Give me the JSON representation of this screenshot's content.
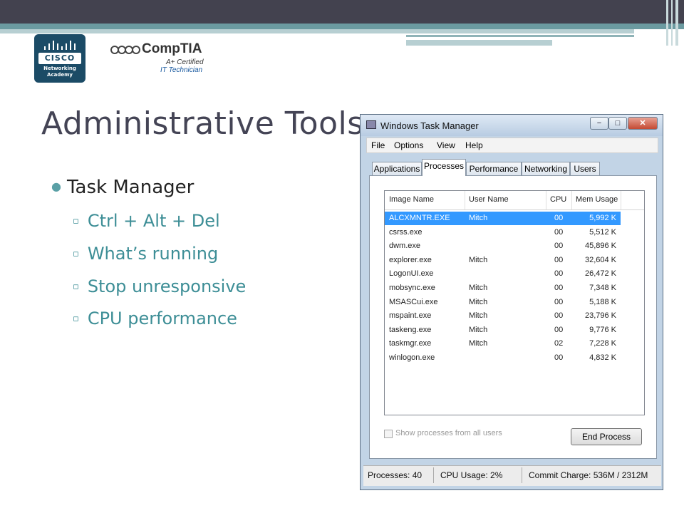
{
  "logos": {
    "cisco_word": "CISCO",
    "cisco_sub1": "Networking",
    "cisco_sub2": "Academy",
    "comptia_brand": "CompTIA",
    "comptia_aplus": "A+ Certified",
    "comptia_itt": "IT Technician"
  },
  "slide": {
    "title": "Administrative Tools",
    "bullet": "Task Manager",
    "sub_bullets": [
      "Ctrl + Alt + Del",
      "What’s running",
      "Stop unresponsive",
      "CPU performance"
    ],
    "accent_color": "#3d8e96"
  },
  "window": {
    "title": "Windows Task Manager",
    "controls": {
      "minimize": "−",
      "maximize": "□",
      "close": "✕"
    },
    "menu": [
      "File",
      "Options",
      "View",
      "Help"
    ],
    "tabs": [
      "Applications",
      "Processes",
      "Performance",
      "Networking",
      "Users"
    ],
    "active_tab": "Processes",
    "columns": [
      "Image Name",
      "User Name",
      "CPU",
      "Mem Usage"
    ],
    "processes": [
      {
        "name": "ALCXMNTR.EXE",
        "user": "Mitch",
        "cpu": "00",
        "mem": "5,992 K",
        "selected": true
      },
      {
        "name": "csrss.exe",
        "user": "",
        "cpu": "00",
        "mem": "5,512 K"
      },
      {
        "name": "dwm.exe",
        "user": "",
        "cpu": "00",
        "mem": "45,896 K"
      },
      {
        "name": "explorer.exe",
        "user": "Mitch",
        "cpu": "00",
        "mem": "32,604 K"
      },
      {
        "name": "LogonUI.exe",
        "user": "",
        "cpu": "00",
        "mem": "26,472 K"
      },
      {
        "name": "mobsync.exe",
        "user": "Mitch",
        "cpu": "00",
        "mem": "7,348 K"
      },
      {
        "name": "MSASCui.exe",
        "user": "Mitch",
        "cpu": "00",
        "mem": "5,188 K"
      },
      {
        "name": "mspaint.exe",
        "user": "Mitch",
        "cpu": "00",
        "mem": "23,796 K"
      },
      {
        "name": "taskeng.exe",
        "user": "Mitch",
        "cpu": "00",
        "mem": "9,776 K"
      },
      {
        "name": "taskmgr.exe",
        "user": "Mitch",
        "cpu": "02",
        "mem": "7,228 K"
      },
      {
        "name": "winlogon.exe",
        "user": "",
        "cpu": "00",
        "mem": "4,832 K"
      }
    ],
    "show_all_label": "Show processes from all users",
    "end_process_label": "End Process",
    "status": {
      "processes": "Processes: 40",
      "cpu": "CPU Usage: 2%",
      "commit": "Commit Charge: 536M / 2312M"
    }
  }
}
